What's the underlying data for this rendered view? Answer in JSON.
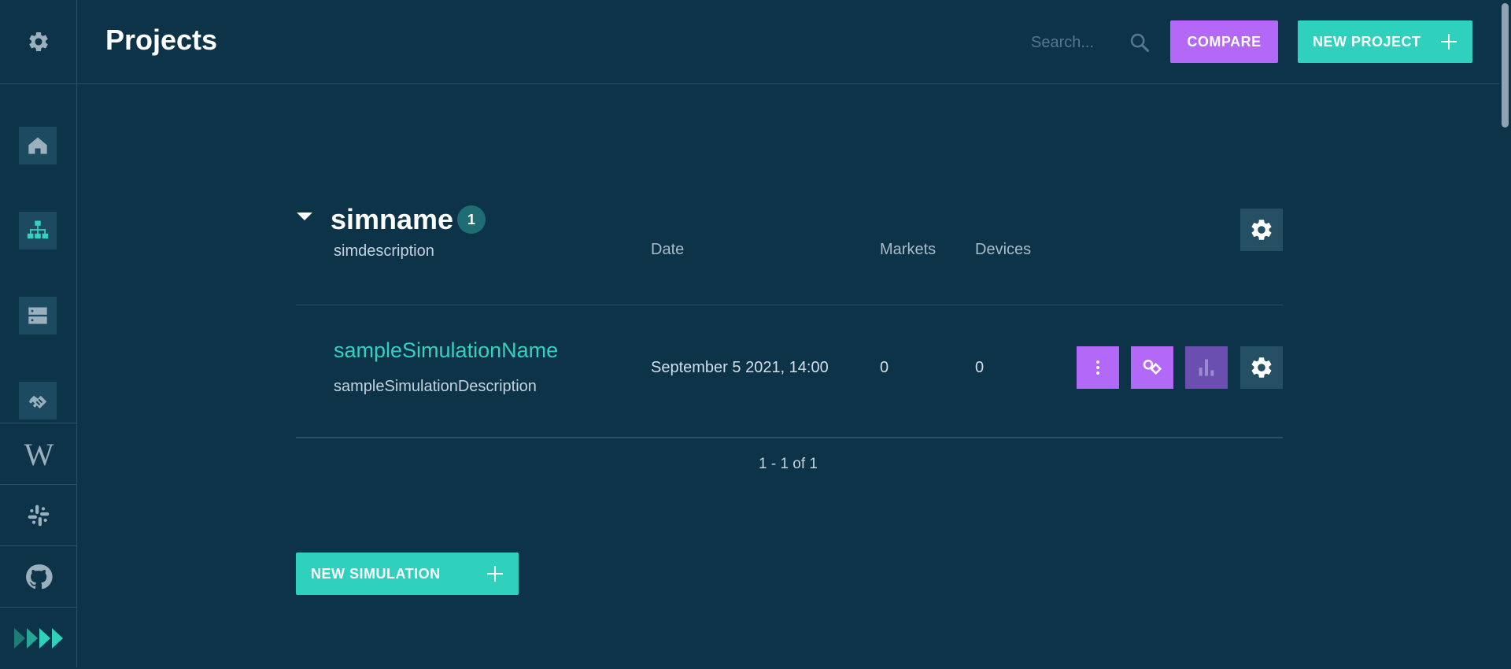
{
  "header": {
    "title": "Projects",
    "search_placeholder": "Search...",
    "compare_label": "COMPARE",
    "new_project_label": "NEW PROJECT"
  },
  "sidebar": {
    "top_icon": "gear-icon",
    "nav": [
      {
        "name": "home",
        "icon": "home-icon"
      },
      {
        "name": "projects",
        "icon": "hierarchy-icon",
        "active": true
      },
      {
        "name": "data",
        "icon": "server-icon"
      },
      {
        "name": "markets",
        "icon": "handshake-icon"
      }
    ],
    "links": [
      {
        "name": "wiki",
        "icon": "wikipedia-icon",
        "glyph": "W"
      },
      {
        "name": "slack",
        "icon": "slack-icon"
      },
      {
        "name": "github",
        "icon": "github-icon"
      },
      {
        "name": "collapse",
        "icon": "fast-forward-icon"
      }
    ]
  },
  "project": {
    "name": "simname",
    "count": "1",
    "description": "simdescription",
    "columns": {
      "date": "Date",
      "markets": "Markets",
      "devices": "Devices"
    },
    "simulations": [
      {
        "name": "sampleSimulationName",
        "description": "sampleSimulationDescription",
        "date": "September 5 2021, 14:00",
        "markets": "0",
        "devices": "0"
      }
    ],
    "pagination": "1 - 1 of 1"
  },
  "new_simulation_label": "NEW SIMULATION",
  "colors": {
    "background": "#0d3349",
    "accent_teal": "#2fd1bd",
    "accent_purple": "#b368f7",
    "muted_purple": "#6b4fb0",
    "tile": "#1b4a61",
    "settings_tile": "#254f62"
  }
}
